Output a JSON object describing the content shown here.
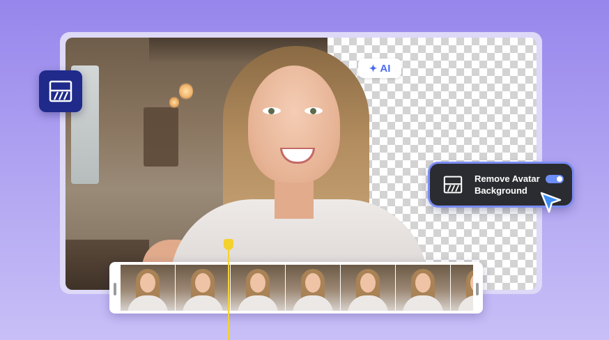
{
  "ai_badge": {
    "label": "AI"
  },
  "toggle": {
    "line1": "Remove Avatar",
    "line2": "Background",
    "enabled": true
  },
  "timeline": {
    "frame_count": 7
  },
  "colors": {
    "accent": "#6d8df7",
    "tool_tile": "#1f2a8a",
    "playhead": "#f5d12e",
    "card_bg": "#2b2c31"
  },
  "icons": [
    "remove-background-icon",
    "sparkle-icon",
    "toggle-switch",
    "pointer-cursor-icon",
    "playhead-handle"
  ]
}
